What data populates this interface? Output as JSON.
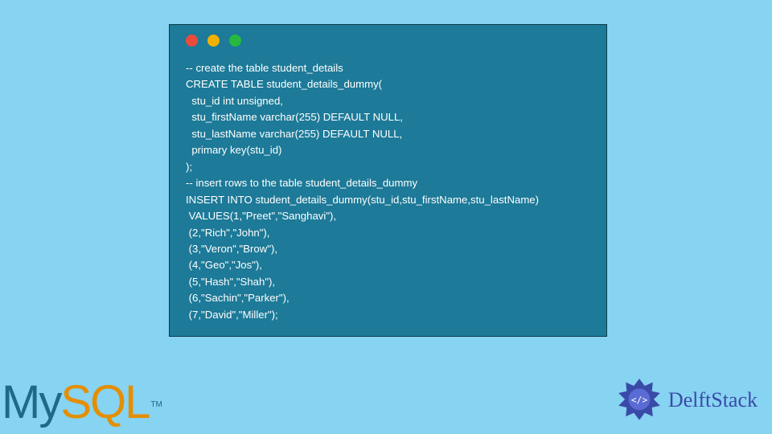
{
  "window": {
    "dots": {
      "red": "#e94b3c",
      "yellow": "#f2b100",
      "green": "#27b93f"
    },
    "bg": "#1d7a98"
  },
  "code": {
    "lines": [
      "-- create the table student_details",
      "CREATE TABLE student_details_dummy(",
      "  stu_id int unsigned,",
      "  stu_firstName varchar(255) DEFAULT NULL,",
      "  stu_lastName varchar(255) DEFAULT NULL,",
      "  primary key(stu_id)",
      ");",
      "-- insert rows to the table student_details_dummy",
      "INSERT INTO student_details_dummy(stu_id,stu_firstName,stu_lastName)",
      " VALUES(1,\"Preet\",\"Sanghavi\"),",
      " (2,\"Rich\",\"John\"),",
      " (3,\"Veron\",\"Brow\"),",
      " (4,\"Geo\",\"Jos\"),",
      " (5,\"Hash\",\"Shah\"),",
      " (6,\"Sachin\",\"Parker\"),",
      " (7,\"David\",\"Miller\");"
    ]
  },
  "logos": {
    "mysql": {
      "my": "My",
      "sql": "SQL",
      "tm": "TM"
    },
    "delftstack": {
      "text": "DelftStack"
    }
  }
}
